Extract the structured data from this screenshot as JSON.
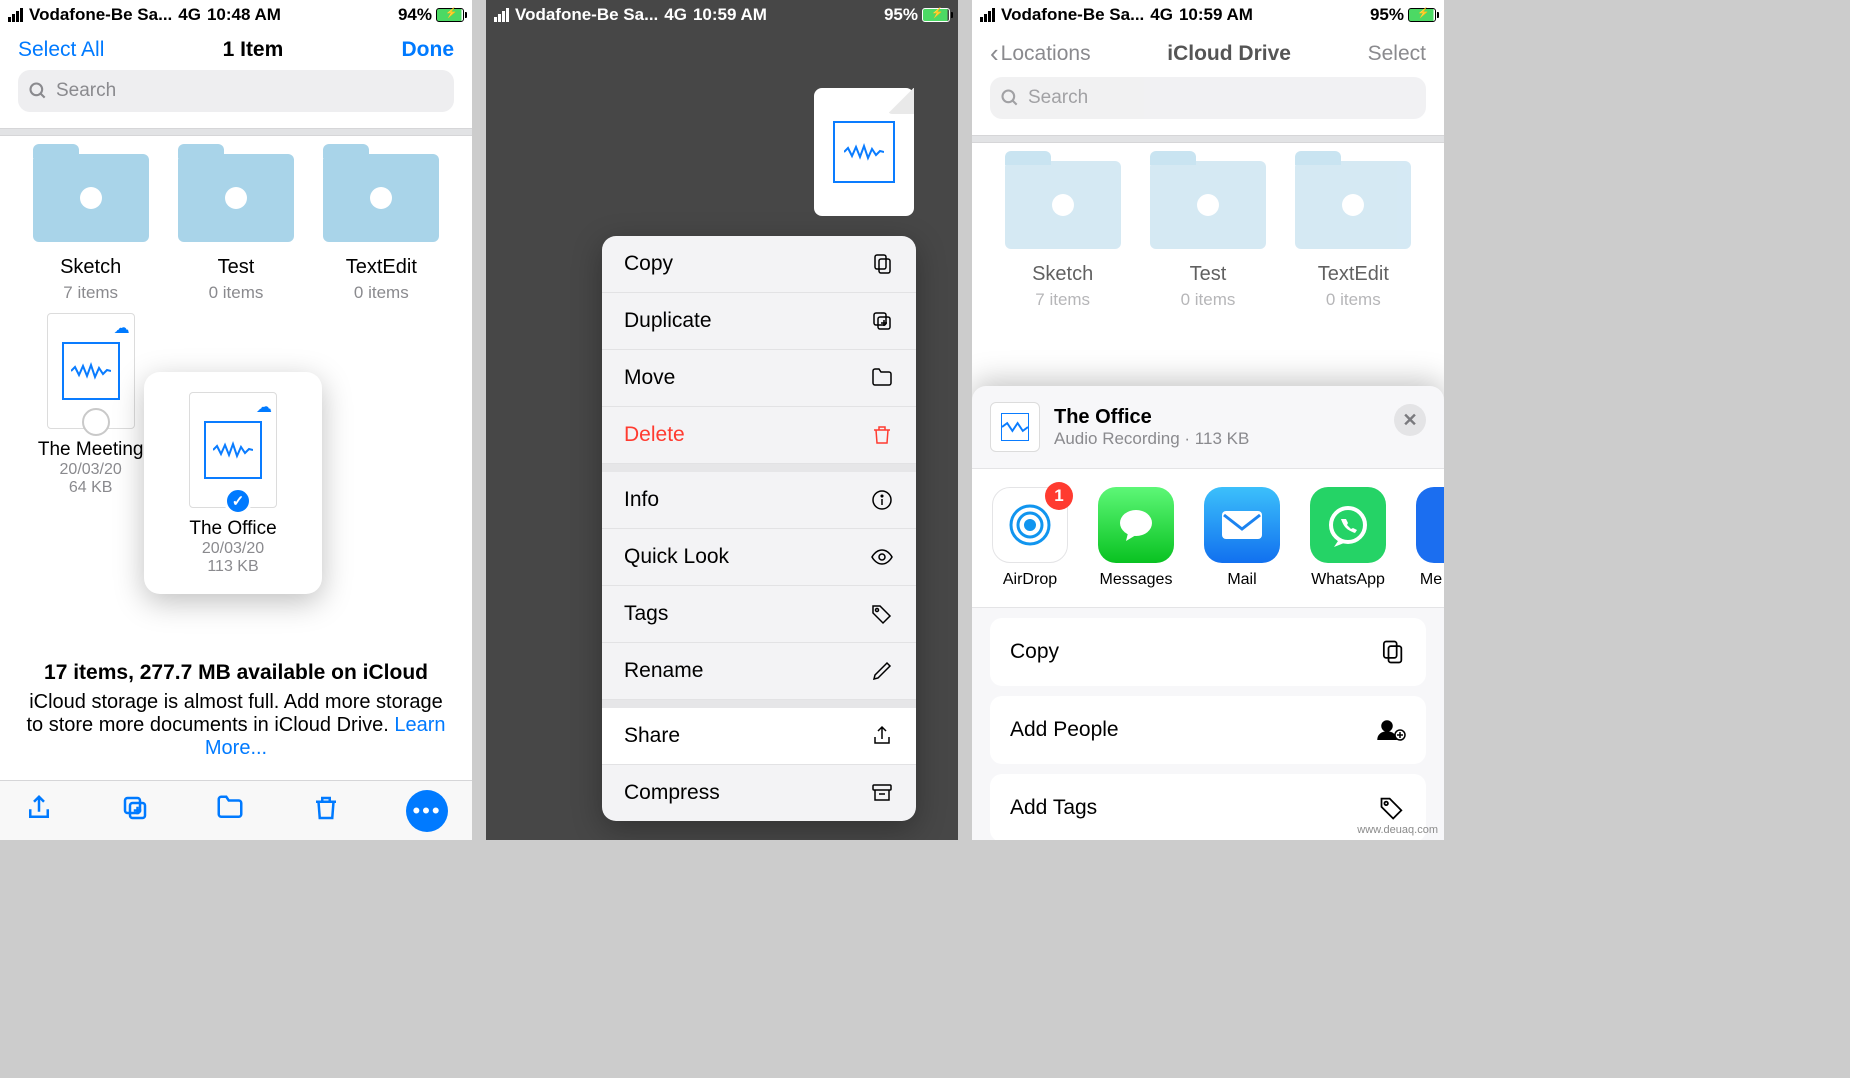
{
  "screen1": {
    "status": {
      "carrier": "Vodafone-Be Sa...",
      "network": "4G",
      "time": "10:48 AM",
      "battery": "94%"
    },
    "nav": {
      "left": "Select All",
      "title": "1 Item",
      "right": "Done"
    },
    "search_placeholder": "Search",
    "folders": [
      {
        "name": "Sketch",
        "sub": "7 items"
      },
      {
        "name": "Test",
        "sub": "0 items"
      },
      {
        "name": "TextEdit",
        "sub": "0 items"
      }
    ],
    "files": [
      {
        "name": "The Meeting",
        "date": "20/03/20",
        "size": "64 KB"
      }
    ],
    "selected_file": {
      "name": "The Office",
      "date": "20/03/20",
      "size": "113 KB"
    },
    "footer": {
      "summary": "17 items, 277.7 MB available on iCloud",
      "detail": "iCloud storage is almost full. Add more storage to store more documents in iCloud Drive. ",
      "learn": "Learn More..."
    }
  },
  "screen2": {
    "status": {
      "carrier": "Vodafone-Be Sa...",
      "network": "4G",
      "time": "10:59 AM",
      "battery": "95%"
    },
    "menu": {
      "copy": "Copy",
      "duplicate": "Duplicate",
      "move": "Move",
      "delete": "Delete",
      "info": "Info",
      "quicklook": "Quick Look",
      "tags": "Tags",
      "rename": "Rename",
      "share": "Share",
      "compress": "Compress"
    }
  },
  "screen3": {
    "status": {
      "carrier": "Vodafone-Be Sa...",
      "network": "4G",
      "time": "10:59 AM",
      "battery": "95%"
    },
    "nav": {
      "back": "Locations",
      "title": "iCloud Drive",
      "right": "Select"
    },
    "search_placeholder": "Search",
    "folders": [
      {
        "name": "Sketch",
        "sub": "7 items"
      },
      {
        "name": "Test",
        "sub": "0 items"
      },
      {
        "name": "TextEdit",
        "sub": "0 items"
      }
    ],
    "share_header": {
      "title": "The Office",
      "sub": "Audio Recording · 113 KB"
    },
    "share_apps": [
      {
        "name": "AirDrop",
        "badge": "1"
      },
      {
        "name": "Messages"
      },
      {
        "name": "Mail"
      },
      {
        "name": "WhatsApp"
      },
      {
        "name": "Me"
      }
    ],
    "share_actions": {
      "copy": "Copy",
      "add_people": "Add People",
      "add_tags": "Add Tags"
    }
  },
  "watermark": "www.deuaq.com"
}
